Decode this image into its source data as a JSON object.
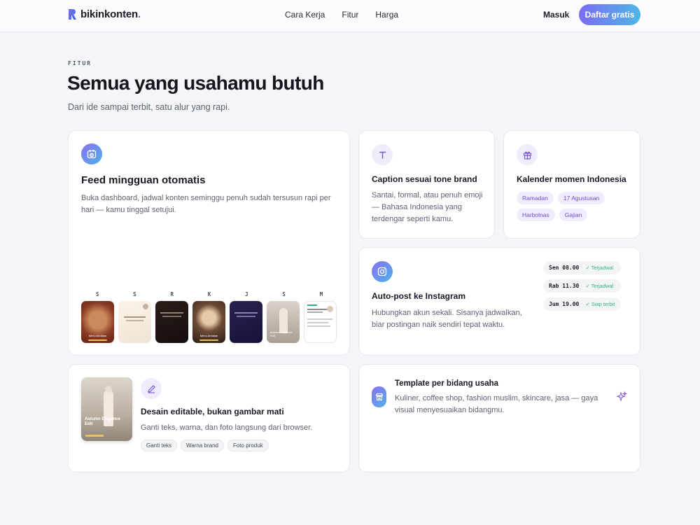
{
  "nav": {
    "logo": "bikinkonten",
    "logo_dot": ".",
    "links": [
      "Cara Kerja",
      "Fitur",
      "Harga"
    ],
    "login": "Masuk",
    "cta": "Daftar gratis"
  },
  "hero": {
    "eyebrow": "FITUR",
    "title": "Semua yang usahamu butuh",
    "subtitle": "Dari ide sampai terbit, satu alur yang rapi."
  },
  "features": {
    "feed": {
      "title": "Feed mingguan otomatis",
      "desc": "Buka dashboard, jadwal konten seminggu penuh sudah tersusun rapi per hari — kamu tinggal setujui.",
      "days": [
        "S",
        "S",
        "R",
        "K",
        "J",
        "S",
        "M"
      ],
      "thumbs": [
        {
          "caption": "Menu Andalan"
        },
        {
          "caption": ""
        },
        {
          "caption": ""
        },
        {
          "caption": "Menu Andalan"
        },
        {
          "caption": ""
        },
        {
          "caption": "Autumn Elegance Edit"
        },
        {
          "caption": ""
        }
      ]
    },
    "caption": {
      "title": "Caption sesuai tone brand",
      "desc": "Santai, formal, atau penuh emoji — Bahasa Indonesia yang terdengar seperti kamu."
    },
    "calendar": {
      "title": "Kalender momen Indonesia",
      "chips": [
        "Ramadan",
        "17 Agustusan",
        "Harbolnas",
        "Gajian"
      ]
    },
    "autopost": {
      "title": "Auto-post ke Instagram",
      "desc": "Hubungkan akun sekali. Sisanya jadwalkan, biar postingan naik sendiri tepat waktu.",
      "schedule": [
        {
          "time": "Sen 08.00",
          "status": "✓ Terjadwal"
        },
        {
          "time": "Rab 11.30",
          "status": "✓ Terjadwal"
        },
        {
          "time": "Jum 19.00",
          "status": "✓ Siap terbit"
        }
      ]
    },
    "editable": {
      "title": "Desain editable, bukan gambar mati",
      "desc": "Ganti teks, warna, dan foto langsung dari browser.",
      "image_caption": "Autumn Elegance Edit",
      "tags": [
        "Ganti teks",
        "Warna brand",
        "Foto produk"
      ]
    },
    "template": {
      "title": "Template per bidang usaha",
      "desc": "Kuliner, coffee shop, fashion muslim, skincare, jasa — gaya visual menyesuaikan bidangmu."
    }
  },
  "colors": {
    "accent": "#7b6cf4",
    "accent_2": "#4fb6e6",
    "chip_bg": "#f1ecfd",
    "success": "#2fb37a"
  }
}
